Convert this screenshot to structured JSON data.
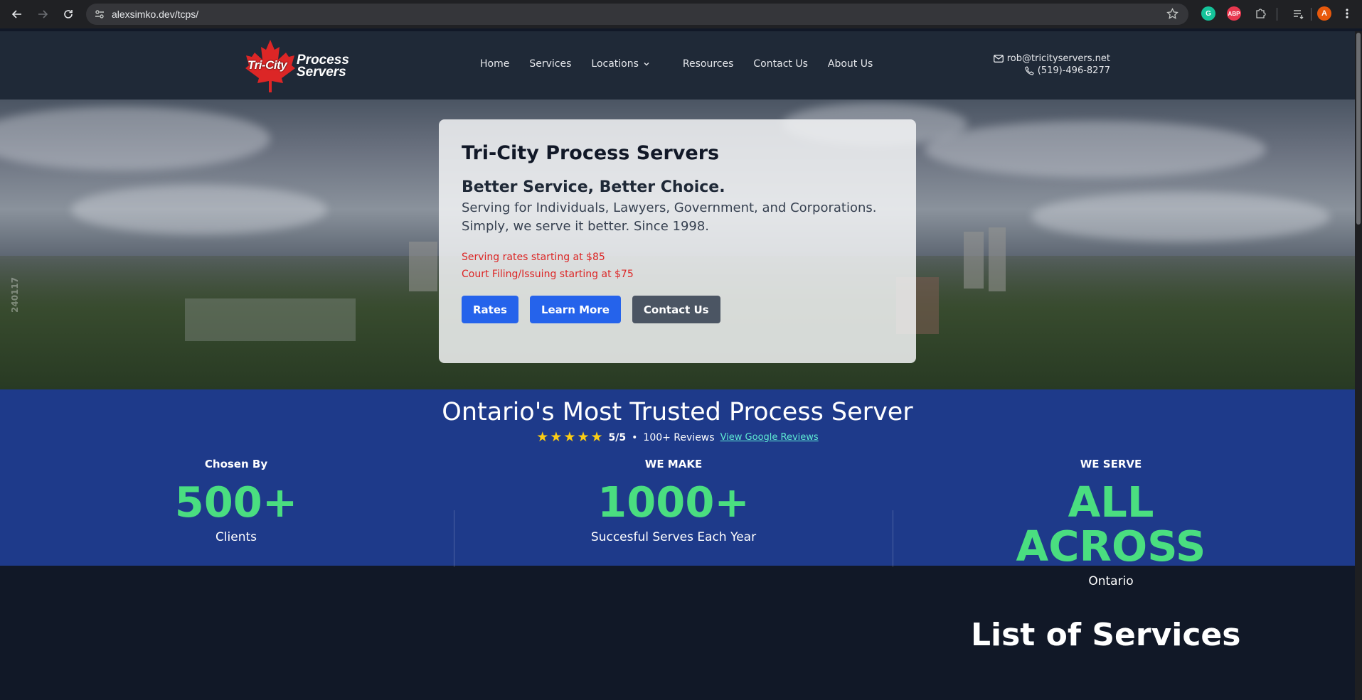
{
  "browser": {
    "url": "alexsimko.dev/tcps/",
    "profile_initial": "A",
    "extensions": [
      "grammarly-icon",
      "adblock-icon",
      "puzzle-icon"
    ],
    "adblock_label": "ABP",
    "grammarly_label": "G"
  },
  "site": {
    "logo_text_1": "Tri-City",
    "logo_text_2a": "Process",
    "logo_text_2b": "Servers",
    "nav": {
      "home": "Home",
      "services": "Services",
      "locations": "Locations",
      "resources": "Resources",
      "contact": "Contact Us",
      "about": "About Us"
    },
    "email": "rob@tricityservers.net",
    "phone": "(519)-496-8277"
  },
  "hero": {
    "title": "Tri-City Process Servers",
    "tagline": "Better Service, Better Choice.",
    "sub_line1": "Serving for Individuals, Lawyers, Government, and Corporations.",
    "sub_line2": "Simply, we serve it better. Since 1998.",
    "rate1": "Serving rates starting at $85",
    "rate2": "Court Filing/Issuing starting at $75",
    "btn_rates": "Rates",
    "btn_learn": "Learn More",
    "btn_contact": "Contact Us",
    "watermark": "240117"
  },
  "trust": {
    "heading": "Ontario's Most Trusted Process Server",
    "score": "5/5",
    "dot": "•",
    "reviews": "100+ Reviews",
    "google_link": "View Google Reviews",
    "star_count": 5,
    "stats": [
      {
        "label": "Chosen By",
        "number": "500+",
        "caption": "Clients"
      },
      {
        "label": "WE MAKE",
        "number": "1000+",
        "caption": "Succesful Serves Each Year"
      },
      {
        "label": "WE SERVE",
        "number": "ALL ACROSS",
        "caption": "Ontario"
      }
    ]
  },
  "services": {
    "heading": "List of Services"
  },
  "colors": {
    "accent_green": "#4ade80",
    "band_blue": "#1e3a8a",
    "button_blue": "#2563eb",
    "rate_red": "#dc2626"
  }
}
